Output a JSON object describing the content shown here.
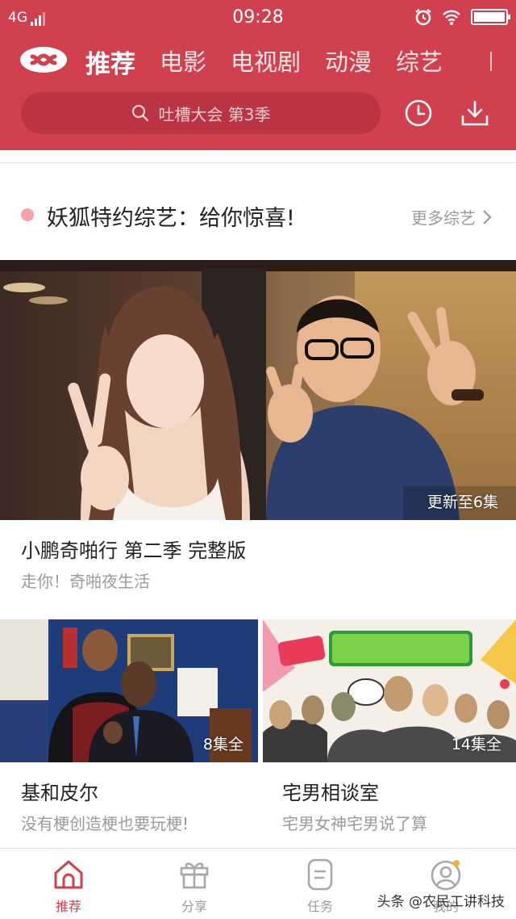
{
  "status_bar": {
    "network": "4G",
    "time": "09:28"
  },
  "nav": {
    "tabs": [
      "推荐",
      "电影",
      "电视剧",
      "动漫",
      "综艺"
    ]
  },
  "search": {
    "placeholder": "吐槽大会 第3季"
  },
  "section": {
    "title": "妖狐特约综艺：给你惊喜!",
    "more": "更多综艺"
  },
  "featured": {
    "badge": "更新至6集",
    "title": "小鹏奇啪行 第二季 完整版",
    "subtitle": "走你！奇啪夜生活"
  },
  "grid": [
    {
      "badge": "8集全",
      "title": "基和皮尔",
      "subtitle": "没有梗创造梗也要玩梗!"
    },
    {
      "badge": "14集全",
      "title": "宅男相谈室",
      "subtitle": "宅男女神宅男说了算"
    }
  ],
  "bottom_nav": [
    {
      "label": "推荐",
      "icon": "home-icon",
      "active": true
    },
    {
      "label": "分享",
      "icon": "gift-icon",
      "active": false
    },
    {
      "label": "任务",
      "icon": "task-icon",
      "active": false
    },
    {
      "label": "我的",
      "icon": "profile-icon",
      "active": false
    }
  ],
  "watermark": "头条 @农民工讲科技",
  "colors": {
    "brand": "#d0404f",
    "dot": "#f7a3a6",
    "muted": "#9b9b9b"
  }
}
